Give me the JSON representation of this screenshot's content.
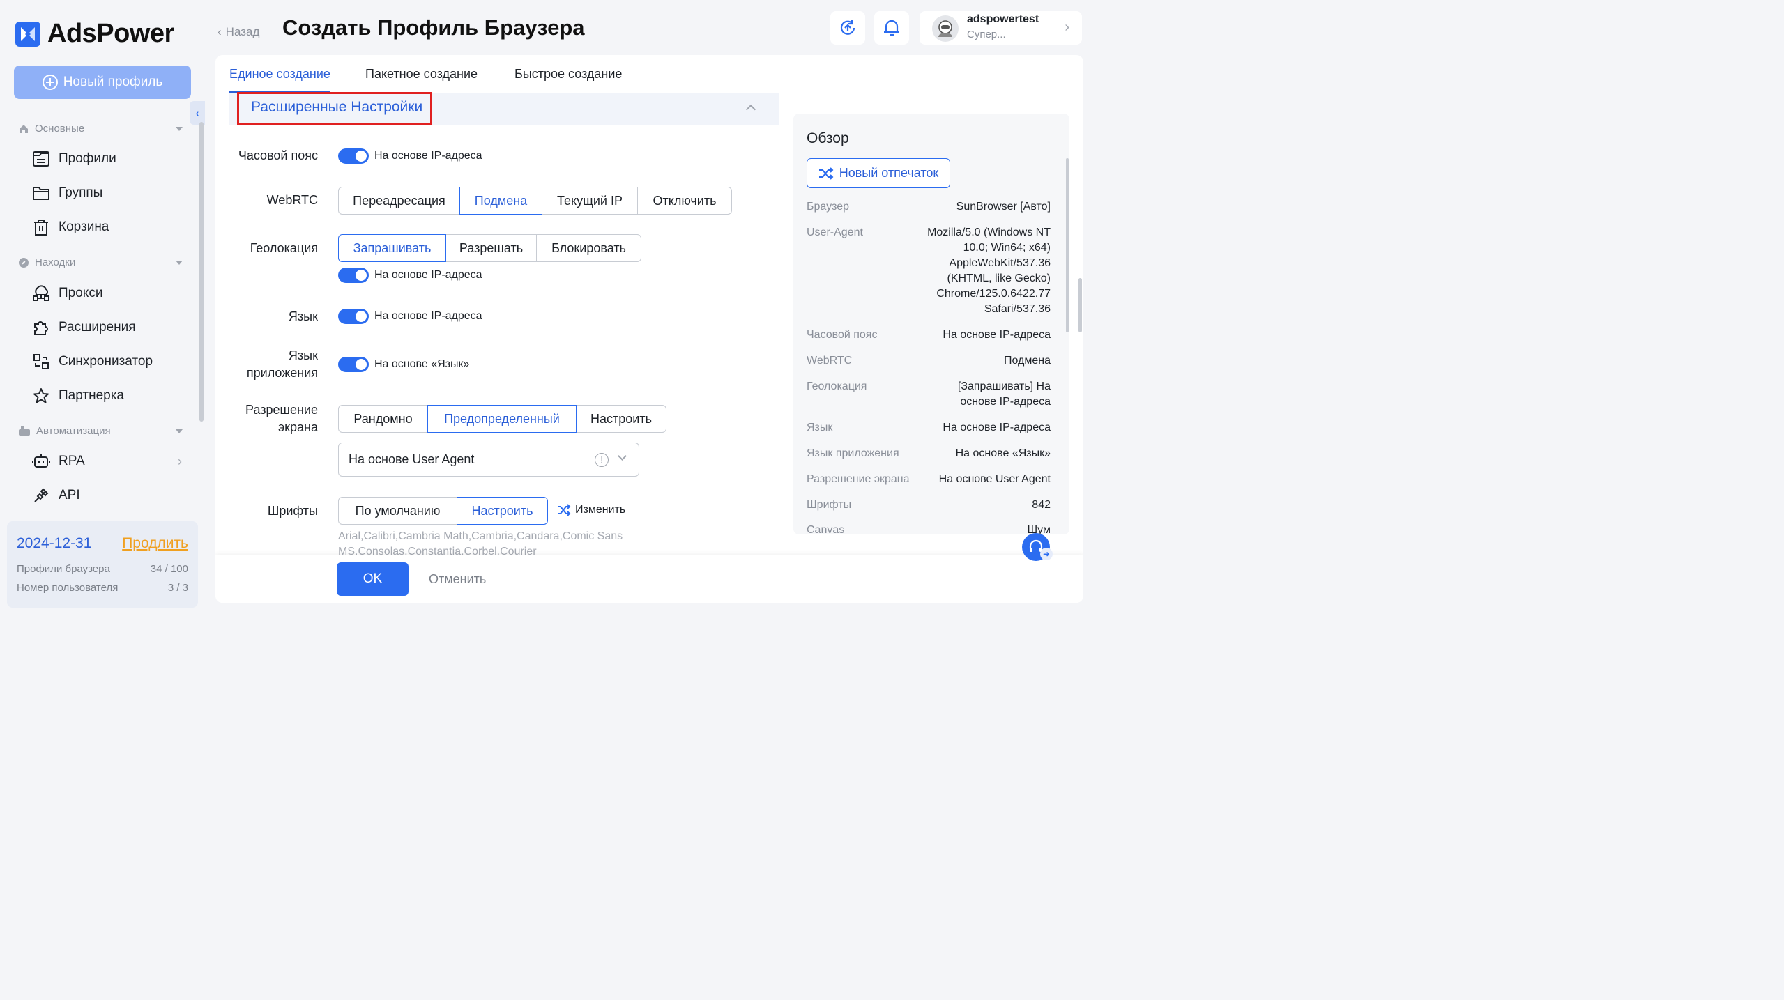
{
  "app": {
    "name": "AdsPower",
    "accent": "#2b6cf0"
  },
  "sidebar": {
    "new_profile": "Новый профиль",
    "sections": [
      {
        "label": "Основные",
        "items": [
          {
            "label": "Профили",
            "icon": "profiles-icon"
          },
          {
            "label": "Группы",
            "icon": "folder-icon"
          },
          {
            "label": "Корзина",
            "icon": "trash-icon"
          }
        ]
      },
      {
        "label": "Находки",
        "items": [
          {
            "label": "Прокси",
            "icon": "proxy-icon"
          },
          {
            "label": "Расширения",
            "icon": "puzzle-icon"
          },
          {
            "label": "Синхронизатор",
            "icon": "sync-icon"
          },
          {
            "label": "Партнерка",
            "icon": "star-icon"
          }
        ]
      },
      {
        "label": "Автоматизация",
        "items": [
          {
            "label": "RPA",
            "icon": "robot-icon"
          },
          {
            "label": "API",
            "icon": "api-icon"
          }
        ]
      }
    ],
    "plan": {
      "date": "2024-12-31",
      "renew": "Продлить",
      "profiles_label": "Профили браузера",
      "profiles_value": "34 / 100",
      "users_label": "Номер пользователя",
      "users_value": "3 / 3"
    }
  },
  "header": {
    "back": "Назад",
    "title": "Создать Профиль Браузера",
    "user": {
      "name": "adspowertest",
      "role": "Супер..."
    }
  },
  "tabs": [
    "Единое создание",
    "Пакетное создание",
    "Быстрое создание"
  ],
  "advanced": {
    "title": "Расширенные Настройки",
    "timezone": {
      "label": "Часовой пояс",
      "toggle_text": "На основе IP-адреса"
    },
    "webrtc": {
      "label": "WebRTC",
      "options": [
        "Переадресация",
        "Подмена",
        "Текущий IP",
        "Отключить"
      ],
      "selected": "Подмена"
    },
    "geo": {
      "label": "Геолокация",
      "options": [
        "Запрашивать",
        "Разрешать",
        "Блокировать"
      ],
      "selected": "Запрашивать",
      "toggle_text": "На основе IP-адреса"
    },
    "language": {
      "label": "Язык",
      "toggle_text": "На основе IP-адреса"
    },
    "app_language": {
      "label_1": "Язык",
      "label_2": "приложения",
      "toggle_text": "На основе «Язык»"
    },
    "resolution": {
      "label_1": "Разрешение",
      "label_2": "экрана",
      "options": [
        "Рандомно",
        "Предопределенный",
        "Настроить"
      ],
      "selected": "Предопределенный",
      "select_value": "На основе User Agent"
    },
    "fonts": {
      "label": "Шрифты",
      "options": [
        "По умолчанию",
        "Настроить"
      ],
      "selected": "Настроить",
      "change": "Изменить",
      "list": "Arial,Calibri,Cambria Math,Cambria,Candara,Comic Sans MS,Consolas,Constantia,Corbel,Courier New,Ebrima,Frankli..."
    }
  },
  "footer": {
    "ok": "OK",
    "cancel": "Отменить"
  },
  "overview": {
    "title": "Обзор",
    "new_fingerprint": "Новый отпечаток",
    "rows": [
      {
        "k": "Браузер",
        "v": "SunBrowser [Авто]"
      },
      {
        "k": "User-Agent",
        "v": "Mozilla/5.0 (Windows NT 10.0; Win64; x64) AppleWebKit/537.36 (KHTML, like Gecko) Chrome/125.0.6422.77 Safari/537.36"
      },
      {
        "k": "Часовой пояс",
        "v": "На основе IP-адреса"
      },
      {
        "k": "WebRTC",
        "v": "Подмена"
      },
      {
        "k": "Геолокация",
        "v": "[Запрашивать] На основе IP-адреса"
      },
      {
        "k": "Язык",
        "v": "На основе IP-адреса"
      },
      {
        "k": "Язык приложения",
        "v": "На основе «Язык»"
      },
      {
        "k": "Разрешение экрана",
        "v": "На основе User Agent"
      },
      {
        "k": "Шрифты",
        "v": "842"
      },
      {
        "k": "Canvas",
        "v": "Шум"
      }
    ]
  }
}
